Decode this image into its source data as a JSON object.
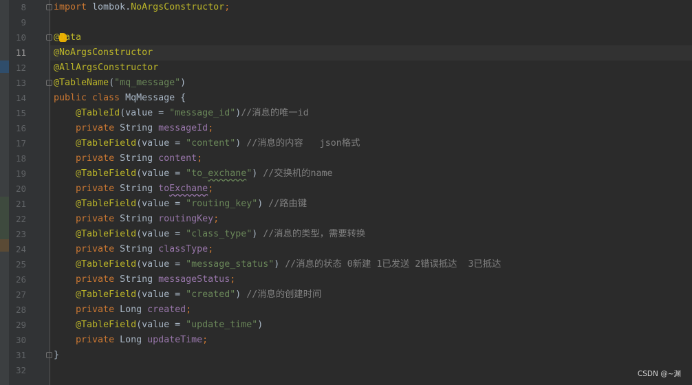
{
  "editor": {
    "current_line": 11,
    "lines": [
      {
        "n": "8",
        "tokens": [
          [
            "kw",
            "import "
          ],
          [
            "param",
            "lombok."
          ],
          [
            "ann",
            "NoArgsConstructor"
          ],
          [
            "kw",
            ";"
          ]
        ]
      },
      {
        "n": "9",
        "tokens": []
      },
      {
        "n": "10",
        "tokens": [
          [
            "ann",
            "@Data"
          ]
        ]
      },
      {
        "n": "11",
        "tokens": [
          [
            "ann",
            "@NoArgsConstructor"
          ]
        ]
      },
      {
        "n": "12",
        "tokens": [
          [
            "ann",
            "@AllArgsConstructor"
          ]
        ]
      },
      {
        "n": "13",
        "tokens": [
          [
            "ann",
            "@TableName"
          ],
          [
            "param",
            "("
          ],
          [
            "str",
            "\"mq_message\""
          ],
          [
            "param",
            ")"
          ]
        ]
      },
      {
        "n": "14",
        "tokens": [
          [
            "kw",
            "public class "
          ],
          [
            "param",
            "MqMessage {"
          ]
        ]
      },
      {
        "n": "15",
        "tokens": [
          [
            "param",
            "    "
          ],
          [
            "ann",
            "@TableId"
          ],
          [
            "param",
            "(value = "
          ],
          [
            "str",
            "\"message_id\""
          ],
          [
            "param",
            ")"
          ],
          [
            "cmt",
            "//消息的唯一id"
          ]
        ]
      },
      {
        "n": "16",
        "tokens": [
          [
            "param",
            "    "
          ],
          [
            "kw",
            "private "
          ],
          [
            "param",
            "String "
          ],
          [
            "fld",
            "messageId"
          ],
          [
            "kw",
            ";"
          ]
        ]
      },
      {
        "n": "17",
        "tokens": [
          [
            "param",
            "    "
          ],
          [
            "ann",
            "@TableField"
          ],
          [
            "param",
            "(value = "
          ],
          [
            "str",
            "\"content\""
          ],
          [
            "param",
            ") "
          ],
          [
            "cmt",
            "//消息的内容   json格式"
          ]
        ]
      },
      {
        "n": "18",
        "tokens": [
          [
            "param",
            "    "
          ],
          [
            "kw",
            "private "
          ],
          [
            "param",
            "String "
          ],
          [
            "fld",
            "content"
          ],
          [
            "kw",
            ";"
          ]
        ]
      },
      {
        "n": "19",
        "tokens": [
          [
            "param",
            "    "
          ],
          [
            "ann",
            "@TableField"
          ],
          [
            "param",
            "(value = "
          ],
          [
            "str",
            "\"to_"
          ],
          [
            "str wavy",
            "exchane"
          ],
          [
            "str",
            "\""
          ],
          [
            "param",
            ") "
          ],
          [
            "cmt",
            "//交换机的name"
          ]
        ]
      },
      {
        "n": "20",
        "tokens": [
          [
            "param",
            "    "
          ],
          [
            "kw",
            "private "
          ],
          [
            "param",
            "String "
          ],
          [
            "fld",
            "to"
          ],
          [
            "fld wavy-f",
            "Exchane"
          ],
          [
            "kw",
            ";"
          ]
        ]
      },
      {
        "n": "21",
        "tokens": [
          [
            "param",
            "    "
          ],
          [
            "ann",
            "@TableField"
          ],
          [
            "param",
            "(value = "
          ],
          [
            "str",
            "\"routing_key\""
          ],
          [
            "param",
            ") "
          ],
          [
            "cmt",
            "//路由键"
          ]
        ]
      },
      {
        "n": "22",
        "tokens": [
          [
            "param",
            "    "
          ],
          [
            "kw",
            "private "
          ],
          [
            "param",
            "String "
          ],
          [
            "fld",
            "routingKey"
          ],
          [
            "kw",
            ";"
          ]
        ]
      },
      {
        "n": "23",
        "tokens": [
          [
            "param",
            "    "
          ],
          [
            "ann",
            "@TableField"
          ],
          [
            "param",
            "(value = "
          ],
          [
            "str",
            "\"class_type\""
          ],
          [
            "param",
            ") "
          ],
          [
            "cmt",
            "//消息的类型，需要转换"
          ]
        ]
      },
      {
        "n": "24",
        "tokens": [
          [
            "param",
            "    "
          ],
          [
            "kw",
            "private "
          ],
          [
            "param",
            "String "
          ],
          [
            "fld",
            "classType"
          ],
          [
            "kw",
            ";"
          ]
        ]
      },
      {
        "n": "25",
        "tokens": [
          [
            "param",
            "    "
          ],
          [
            "ann",
            "@TableField"
          ],
          [
            "param",
            "(value = "
          ],
          [
            "str",
            "\"message_status\""
          ],
          [
            "param",
            ") "
          ],
          [
            "cmt",
            "//消息的状态 0新建 1已发送 2错误抵达  3已抵达"
          ]
        ]
      },
      {
        "n": "26",
        "tokens": [
          [
            "param",
            "    "
          ],
          [
            "kw",
            "private "
          ],
          [
            "param",
            "String "
          ],
          [
            "fld",
            "messageStatus"
          ],
          [
            "kw",
            ";"
          ]
        ]
      },
      {
        "n": "27",
        "tokens": [
          [
            "param",
            "    "
          ],
          [
            "ann",
            "@TableField"
          ],
          [
            "param",
            "(value = "
          ],
          [
            "str",
            "\"created\""
          ],
          [
            "param",
            ") "
          ],
          [
            "cmt",
            "//消息的创建时间"
          ]
        ]
      },
      {
        "n": "28",
        "tokens": [
          [
            "param",
            "    "
          ],
          [
            "kw",
            "private "
          ],
          [
            "param",
            "Long "
          ],
          [
            "fld",
            "created"
          ],
          [
            "kw",
            ";"
          ]
        ]
      },
      {
        "n": "29",
        "tokens": [
          [
            "param",
            "    "
          ],
          [
            "ann",
            "@TableField"
          ],
          [
            "param",
            "(value = "
          ],
          [
            "str",
            "\"update_time\""
          ],
          [
            "param",
            ")"
          ]
        ]
      },
      {
        "n": "30",
        "tokens": [
          [
            "param",
            "    "
          ],
          [
            "kw",
            "private "
          ],
          [
            "param",
            "Long "
          ],
          [
            "fld",
            "updateTime"
          ],
          [
            "kw",
            ";"
          ]
        ]
      },
      {
        "n": "31",
        "tokens": [
          [
            "param",
            "}"
          ]
        ]
      },
      {
        "n": "32",
        "tokens": []
      }
    ]
  },
  "watermark": "CSDN @~渊"
}
